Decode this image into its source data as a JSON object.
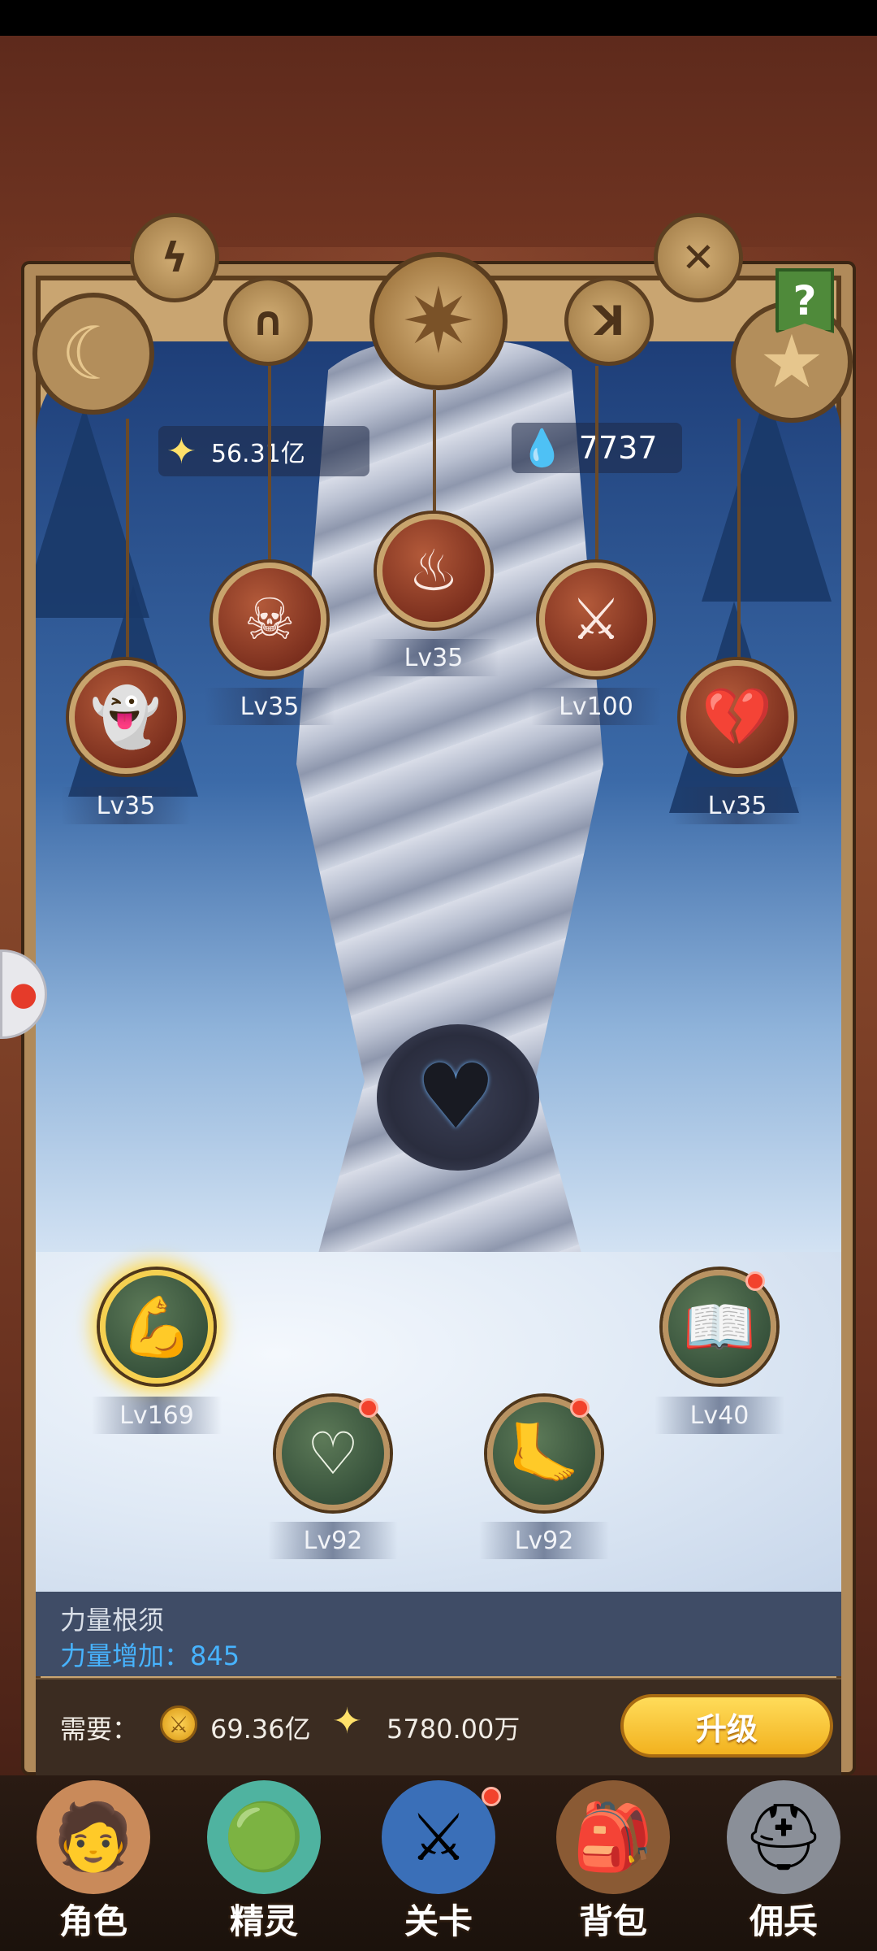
{
  "resources": {
    "stars_value": "56.31亿",
    "water_value": "7737"
  },
  "help_label": "?",
  "top_nodes": [
    {
      "name": "ghost",
      "glyph": "👻",
      "level": "Lv35"
    },
    {
      "name": "demon-skull",
      "glyph": "☠",
      "level": "Lv35"
    },
    {
      "name": "flame-crest",
      "glyph": "♨",
      "level": "Lv35"
    },
    {
      "name": "broken-sword",
      "glyph": "⚔",
      "level": "Lv100"
    },
    {
      "name": "broken-heart",
      "glyph": "💔",
      "level": "Lv35"
    }
  ],
  "bottom_nodes": [
    {
      "name": "strength-arm",
      "glyph": "💪",
      "level": "Lv169",
      "selected": true,
      "badge": false
    },
    {
      "name": "heart",
      "glyph": "♡",
      "level": "Lv92",
      "badge": true
    },
    {
      "name": "swift-foot",
      "glyph": "🦶",
      "level": "Lv92",
      "badge": true
    },
    {
      "name": "spell-book",
      "glyph": "📖",
      "level": "Lv40",
      "badge": true
    }
  ],
  "info": {
    "title": "力量根须",
    "description": "力量增加：845"
  },
  "cost": {
    "need_label": "需要：",
    "gold_value": "69.36亿",
    "stars_value": "5780.00万",
    "upgrade_label": "升级"
  },
  "nav": [
    {
      "label": "角色",
      "glyph": "🧑"
    },
    {
      "label": "精灵",
      "glyph": "🟢"
    },
    {
      "label": "关卡",
      "glyph": "⚔"
    },
    {
      "label": "背包",
      "glyph": "🎒"
    },
    {
      "label": "佣兵",
      "glyph": "⛑"
    }
  ],
  "colors": {
    "accent_gold": "#f2b21f",
    "info_blue": "#47b3ff",
    "badge_red": "#f2422c"
  }
}
